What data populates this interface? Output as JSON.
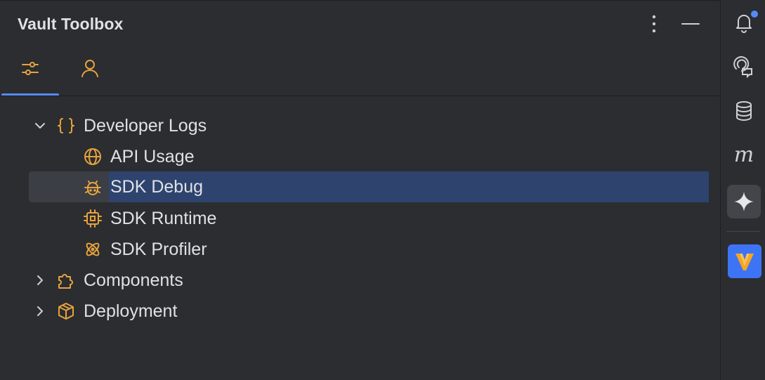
{
  "panel": {
    "title": "Vault Toolbox",
    "more_icon": "vertical-ellipsis-icon",
    "minimize_icon": "minimize-icon"
  },
  "tabs": [
    {
      "icon": "sliders-icon",
      "selected": true
    },
    {
      "icon": "person-icon",
      "selected": false
    }
  ],
  "tree": [
    {
      "label": "Developer Logs",
      "icon": "braces-icon",
      "expanded": true,
      "level": 0,
      "children": [
        {
          "label": "API Usage",
          "icon": "globe-icon"
        },
        {
          "label": "SDK Debug",
          "icon": "bug-icon",
          "selected": true
        },
        {
          "label": "SDK Runtime",
          "icon": "chip-icon"
        },
        {
          "label": "SDK Profiler",
          "icon": "atom-icon"
        }
      ]
    },
    {
      "label": "Components",
      "icon": "puzzle-icon",
      "expanded": false,
      "level": 0
    },
    {
      "label": "Deployment",
      "icon": "package-icon",
      "expanded": false,
      "level": 0
    }
  ],
  "right_toolbar": [
    {
      "icon": "notifications-bell-icon",
      "badge": true
    },
    {
      "icon": "ai-chat-icon"
    },
    {
      "icon": "database-icon"
    },
    {
      "icon": "m-icon",
      "glyph": "m"
    },
    {
      "icon": "sparkle-icon",
      "active": true
    },
    {
      "icon": "vault-logo-icon",
      "glyph": "V"
    }
  ],
  "colors": {
    "background": "#2b2d30",
    "selection": "#2e436e",
    "accent": "#548af7",
    "icon_orange": "#e8a33d",
    "text": "#dfe1e5"
  }
}
